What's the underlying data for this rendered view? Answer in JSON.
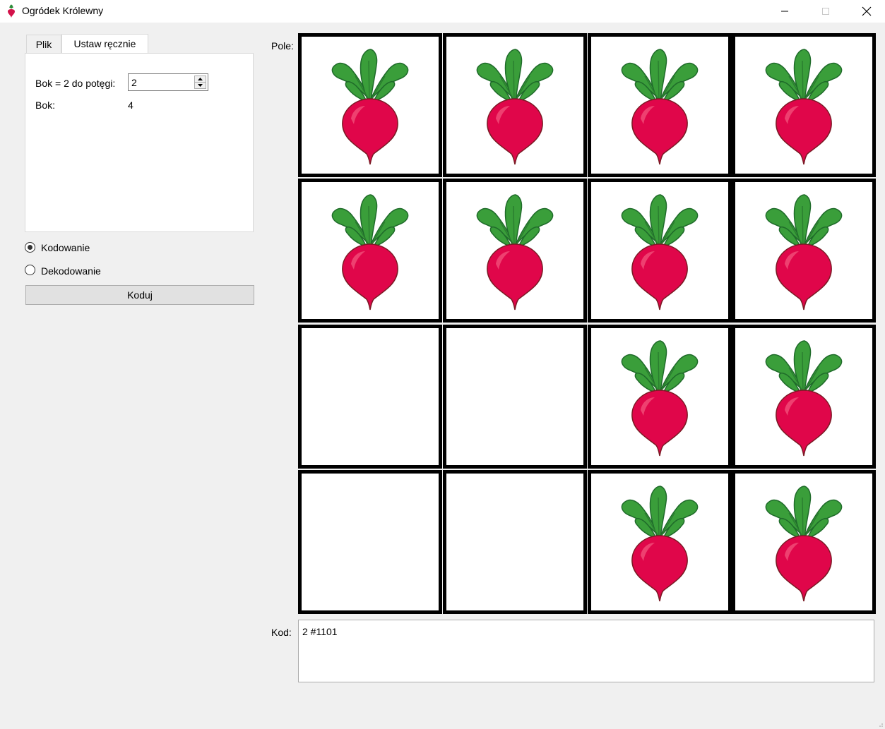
{
  "window": {
    "title": "Ogródek Królewny",
    "icon": "radish-icon",
    "controls": [
      "minimize-icon",
      "maximize-icon",
      "close-icon"
    ]
  },
  "tabs": [
    {
      "label": "Plik",
      "active": false
    },
    {
      "label": "Ustaw ręcznie",
      "active": true
    }
  ],
  "settings": {
    "side_power_label": "Bok = 2 do potęgi:",
    "side_power_value": "2",
    "side_label": "Bok:",
    "side_value": "4"
  },
  "mode": {
    "options": [
      {
        "label": "Kodowanie",
        "selected": true
      },
      {
        "label": "Dekodowanie",
        "selected": false
      }
    ]
  },
  "action_button": "Koduj",
  "field": {
    "label": "Pole:",
    "size": 4,
    "cells": [
      [
        1,
        1,
        1,
        1
      ],
      [
        1,
        1,
        1,
        1
      ],
      [
        0,
        0,
        1,
        1
      ],
      [
        0,
        0,
        1,
        1
      ]
    ],
    "item_icon": "radish-icon"
  },
  "code": {
    "label": "Kod:",
    "value": "2 #1101"
  },
  "colors": {
    "radish_body": "#e0064a",
    "radish_outline": "#7a1a24",
    "leaves": "#3a9e3a",
    "leaf_outline": "#1f6b2a"
  }
}
